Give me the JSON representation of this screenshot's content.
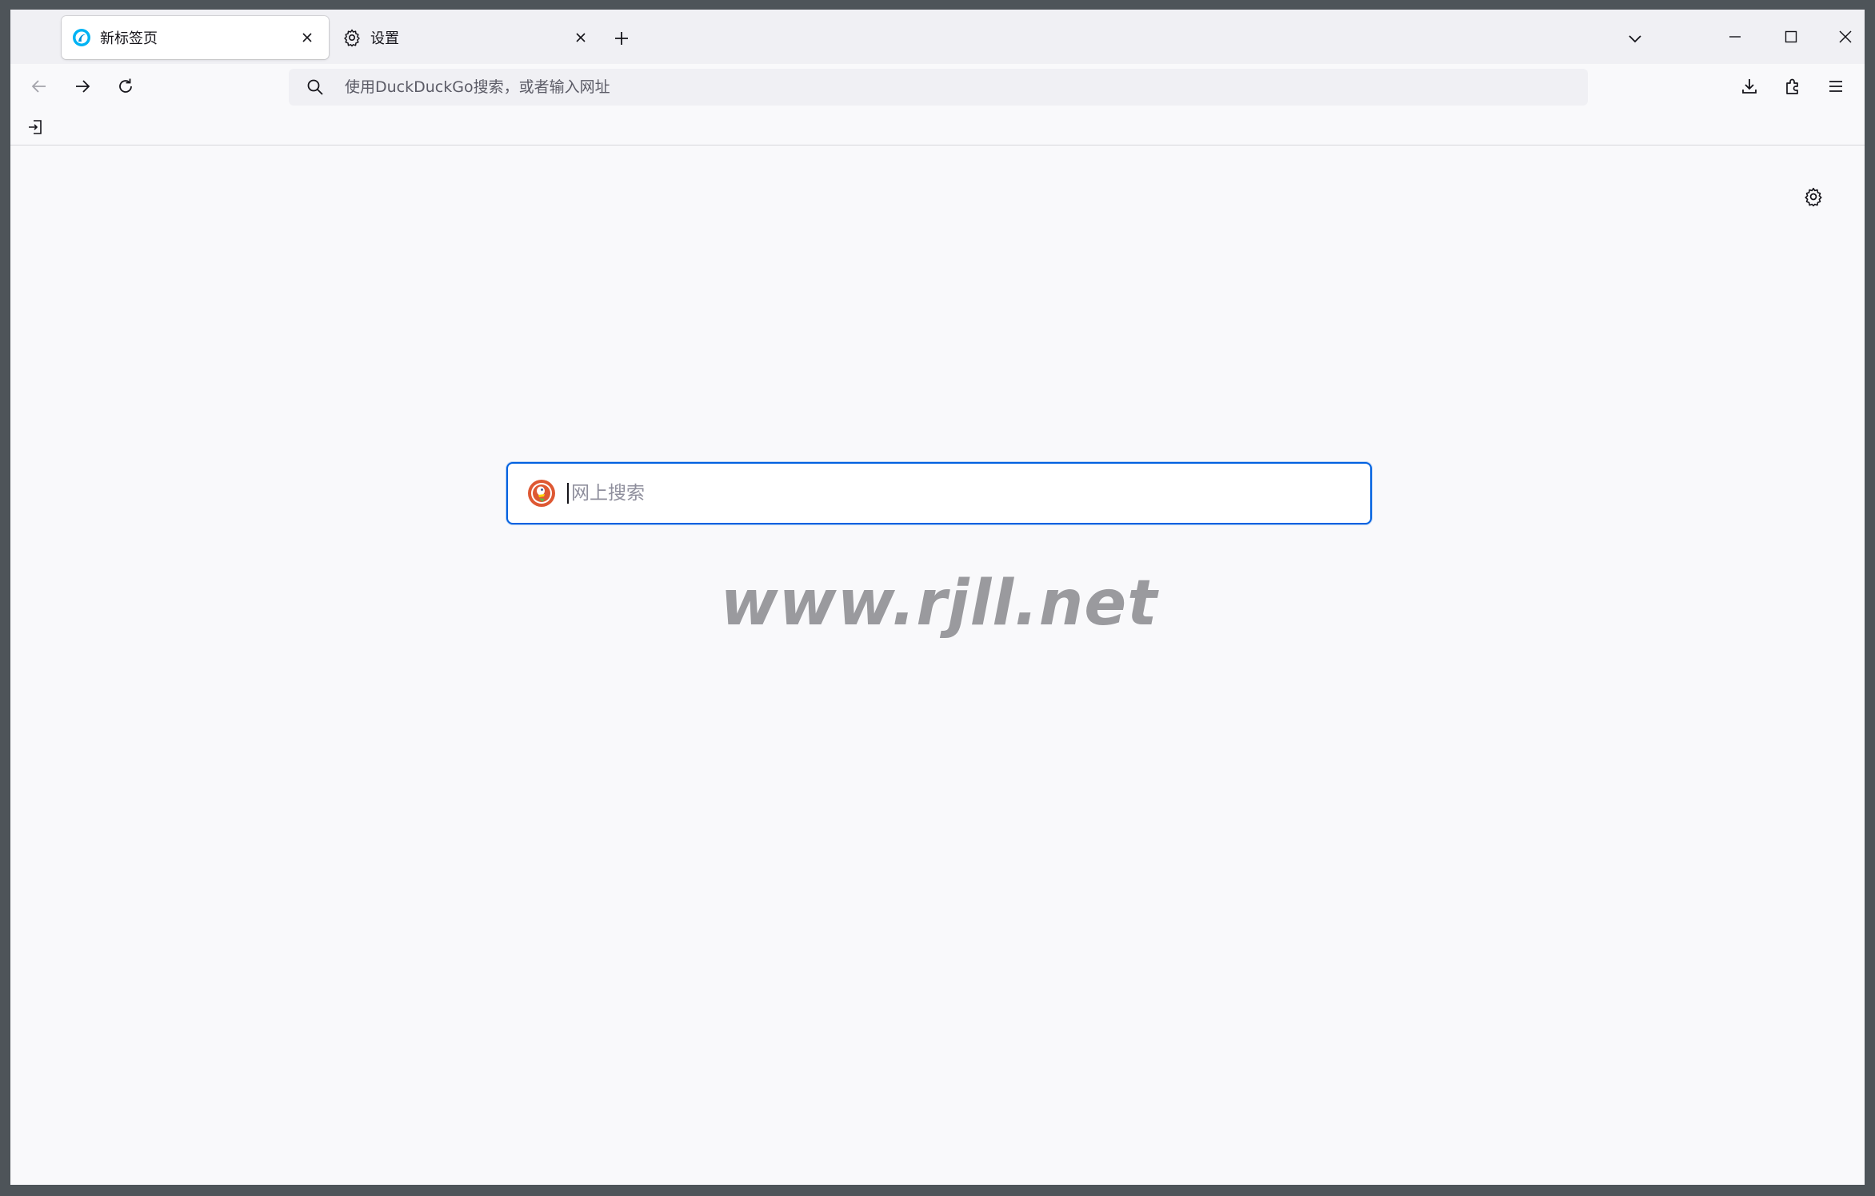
{
  "tabs": [
    {
      "label": "新标签页",
      "active": true,
      "icon": "firefox-logo-icon"
    },
    {
      "label": "设置",
      "active": false,
      "icon": "gear-icon"
    }
  ],
  "toolbar": {
    "url_placeholder": "使用DuckDuckGo搜索，或者输入网址"
  },
  "newtab_page": {
    "search_placeholder": "网上搜索",
    "search_engine_icon": "duckduckgo-icon",
    "watermark": "www.rjll.net"
  },
  "colors": {
    "accent": "#0061e0",
    "tabstrip_bg": "#f0f0f4",
    "page_bg": "#f9f9fb",
    "window_frame": "#4e5459"
  }
}
